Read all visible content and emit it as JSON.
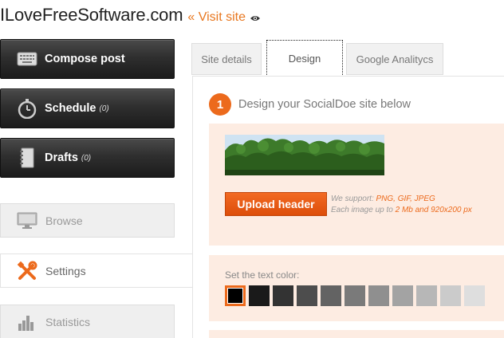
{
  "header": {
    "site_title": "ILoveFreeSoftware.com",
    "visit_link": "« Visit site"
  },
  "sidebar": {
    "buttons": [
      {
        "label": "Compose post",
        "count": "",
        "icon": "keyboard-icon"
      },
      {
        "label": "Schedule",
        "count": "(0)",
        "icon": "stopwatch-icon"
      },
      {
        "label": "Drafts",
        "count": "(0)",
        "icon": "notebook-icon"
      }
    ],
    "items": [
      {
        "label": "Browse",
        "icon": "monitor-icon"
      },
      {
        "label": "Settings",
        "icon": "tools-icon"
      },
      {
        "label": "Statistics",
        "icon": "bar-chart-icon"
      }
    ]
  },
  "tabs": [
    {
      "label": "Site details"
    },
    {
      "label": "Design"
    },
    {
      "label": "Google Analitycs"
    }
  ],
  "main": {
    "step_number": "1",
    "step_title": "Design your SocialDoe site below",
    "upload_button": "Upload header",
    "support_prefix": "We support: ",
    "support_formats": "PNG, GIF, JPEG",
    "size_prefix": "Each image up to ",
    "size_limit": "2 Mb and 920x200 px",
    "color_label": "Set the text color:",
    "swatches": [
      "#000000",
      "#1a1a1a",
      "#333333",
      "#4d4d4d",
      "#636363",
      "#7a7a7a",
      "#8f8f8f",
      "#a3a3a3",
      "#b7b7b7",
      "#cbcbcb",
      "#dedede"
    ]
  },
  "colors": {
    "accent": "#ec6a1c",
    "panel_bg": "#fdece2"
  }
}
